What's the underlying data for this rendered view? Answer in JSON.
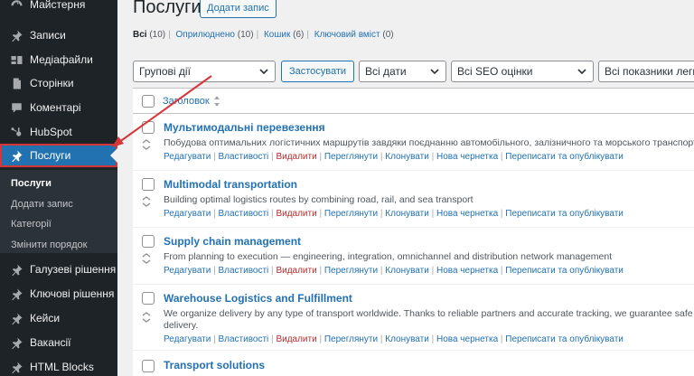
{
  "sidebar": {
    "items": [
      {
        "label": "Майстерня",
        "icon": "dashboard-icon"
      },
      {
        "label": "Записи",
        "icon": "pin-icon"
      },
      {
        "label": "Медіафайли",
        "icon": "media-icon"
      },
      {
        "label": "Сторінки",
        "icon": "page-icon"
      },
      {
        "label": "Коментарі",
        "icon": "comment-icon"
      },
      {
        "label": "HubSpot",
        "icon": "hubspot-icon"
      },
      {
        "label": "Послуги",
        "icon": "pin-icon"
      },
      {
        "label": "Галузеві рішення",
        "icon": "pin-icon"
      },
      {
        "label": "Ключові рішення",
        "icon": "pin-icon"
      },
      {
        "label": "Кейси",
        "icon": "pin-icon"
      },
      {
        "label": "Вакансії",
        "icon": "pin-icon"
      },
      {
        "label": "HTML Blocks",
        "icon": "pin-icon"
      }
    ],
    "submenu": [
      {
        "label": "Послуги"
      },
      {
        "label": "Додати запис"
      },
      {
        "label": "Категорії"
      },
      {
        "label": "Змінити порядок"
      }
    ]
  },
  "main": {
    "title": "Послуги",
    "add_button": "Додати запис",
    "filters": [
      {
        "label": "Всі",
        "count": "(10)"
      },
      {
        "label": "Оприлюднено",
        "count": "(10)"
      },
      {
        "label": "Кошик",
        "count": "(6)"
      },
      {
        "label": "Ключовий вміст",
        "count": "(0)"
      }
    ],
    "bulk_actions": "Групові дії",
    "apply_button": "Застосувати",
    "dates_filter": "Всі дати",
    "seo_filter": "Всі SEO оцінки",
    "readability_filter": "Всі показники легко",
    "column_title": "Заголовок",
    "row_actions": [
      "Редагувати",
      "Властивості",
      "Видалити",
      "Переглянути",
      "Клонувати",
      "Нова чернетка",
      "Переписати та опублікувати"
    ],
    "rows": [
      {
        "title": "Мультимодальні перевезення",
        "desc": "Побудова оптимальних логістичних маршрутів завдяки поєднанню автомобільного, залізничного та морського транспорту"
      },
      {
        "title": "Multimodal transportation",
        "desc": "Building optimal logistics routes by combining road, rail, and sea transport"
      },
      {
        "title": "Supply chain management",
        "desc": "From planning to execution — engineering, integration, omnichannel and distribution network management"
      },
      {
        "title": "Warehouse Logistics and Fulfillment",
        "desc": "We organize delivery by any type of transport worldwide. Thanks to reliable partners and accurate tracking, we guarantee safe and",
        "desc2": "delivery."
      },
      {
        "title": "Transport solutions",
        "desc": ""
      }
    ]
  },
  "colors": {
    "sidebar_bg": "#1d2327",
    "active_bg": "#2271b1",
    "link": "#2271b1",
    "delete": "#b32d2e",
    "highlight": "#d63638"
  }
}
